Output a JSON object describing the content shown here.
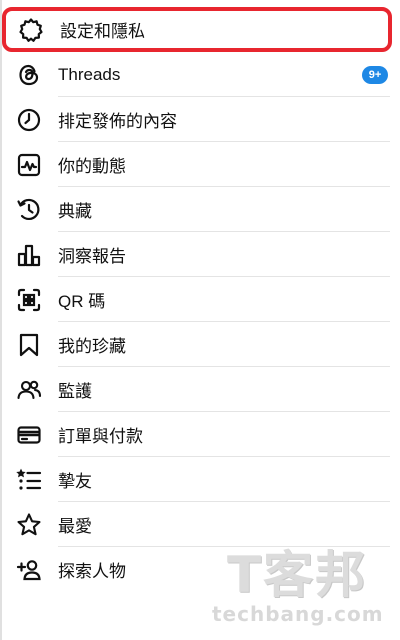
{
  "menu": {
    "items": [
      {
        "label": "設定和隱私",
        "icon": "gear-icon"
      },
      {
        "label": "Threads",
        "icon": "threads-icon",
        "badge": "9+"
      },
      {
        "label": "排定發佈的內容",
        "icon": "clock-icon"
      },
      {
        "label": "你的動態",
        "icon": "activity-icon"
      },
      {
        "label": "典藏",
        "icon": "archive-icon"
      },
      {
        "label": "洞察報告",
        "icon": "insights-icon"
      },
      {
        "label": "QR 碼",
        "icon": "qr-code-icon"
      },
      {
        "label": "我的珍藏",
        "icon": "bookmark-icon"
      },
      {
        "label": "監護",
        "icon": "supervision-icon"
      },
      {
        "label": "訂單與付款",
        "icon": "card-icon"
      },
      {
        "label": "摯友",
        "icon": "close-friends-icon"
      },
      {
        "label": "最愛",
        "icon": "star-icon"
      },
      {
        "label": "探索人物",
        "icon": "add-person-icon"
      }
    ]
  },
  "colors": {
    "highlight_border": "#e8262f",
    "badge_bg": "#1e88e5"
  },
  "watermark": {
    "logo": "T客邦",
    "site": "techbang.com"
  }
}
